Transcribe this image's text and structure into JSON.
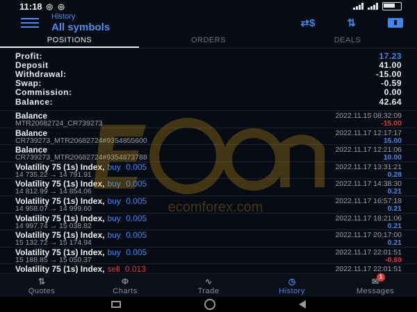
{
  "status": {
    "time": "11:18",
    "left_icons": "◎ ◎",
    "right_icons": "⇅ ▥ ✉",
    "battery_label": ""
  },
  "header": {
    "subtitle": "History",
    "title": "All symbols",
    "currency_icon": "⇄$",
    "sort_icon": "⇅",
    "calendar_icon": "calendar-icon"
  },
  "tabs": [
    {
      "label": "POSITIONS",
      "active": true
    },
    {
      "label": "ORDERS",
      "active": false
    },
    {
      "label": "DEALS",
      "active": false
    }
  ],
  "summary": [
    {
      "label": "Profit:",
      "value": "17.23",
      "blue": true
    },
    {
      "label": "Deposit",
      "value": "41.00",
      "blue": false
    },
    {
      "label": "Withdrawal:",
      "value": "-15.00",
      "blue": false
    },
    {
      "label": "Swap:",
      "value": "-0.59",
      "blue": false
    },
    {
      "label": "Commission:",
      "value": "0.00",
      "blue": false
    },
    {
      "label": "Balance:",
      "value": "42.64",
      "blue": false
    }
  ],
  "deals": [
    {
      "name": "Balance",
      "side": "",
      "volume": "",
      "date": "2022.11.15 08:32:09",
      "sub": "MTR20682724_CR739273",
      "amount": "-15.00",
      "neg": true
    },
    {
      "name": "Balance",
      "side": "",
      "volume": "",
      "date": "2022.11.17 12:17:17",
      "sub": "CR739273_MTR20682724#9354855600",
      "amount": "15.00",
      "neg": false
    },
    {
      "name": "Balance",
      "side": "",
      "volume": "",
      "date": "2022.11.17 12:21:06",
      "sub": "CR739273_MTR20682724#9354873788",
      "amount": "10.00",
      "neg": false
    },
    {
      "name": "Volatility 75 (1s) Index,",
      "side": "buy",
      "volume": "0.005",
      "date": "2022.11.17 13:31:21",
      "sub": "14 735.22 → 14 791.91",
      "amount": "0.28",
      "neg": false
    },
    {
      "name": "Volatility 75 (1s) Index,",
      "side": "buy",
      "volume": "0.005",
      "date": "2022.11.17 14:38:30",
      "sub": "14 812.99 → 14 854.06",
      "amount": "0.21",
      "neg": false
    },
    {
      "name": "Volatility 75 (1s) Index,",
      "side": "buy",
      "volume": "0.005",
      "date": "2022.11.17 16:57:18",
      "sub": "14 958.07 → 14 999.60",
      "amount": "0.21",
      "neg": false
    },
    {
      "name": "Volatility 75 (1s) Index,",
      "side": "buy",
      "volume": "0.005",
      "date": "2022.11.17 18:21:06",
      "sub": "14 997.74 → 15 038.82",
      "amount": "0.21",
      "neg": false
    },
    {
      "name": "Volatility 75 (1s) Index,",
      "side": "buy",
      "volume": "0.005",
      "date": "2022.11.17 20:17:00",
      "sub": "15 132.72 → 15 174.94",
      "amount": "0.21",
      "neg": false
    },
    {
      "name": "Volatility 75 (1s) Index,",
      "side": "buy",
      "volume": "0.005",
      "date": "2022.11.17 22:01:51",
      "sub": "15 188.85 → 15 050.37",
      "amount": "-0.69",
      "neg": true
    },
    {
      "name": "Volatility 75 (1s) Index,",
      "side": "sell",
      "volume": "0.013",
      "date": "2022.11.17 22:01:51",
      "sub": "",
      "amount": "",
      "neg": false
    }
  ],
  "watermark": {
    "text": "ECOM",
    "subtext": "ecomforex.com"
  },
  "bottom_nav": [
    {
      "label": "Quotes",
      "icon": "⇅",
      "active": false
    },
    {
      "label": "Charts",
      "icon": "Φ",
      "active": false
    },
    {
      "label": "Trade",
      "icon": "∿",
      "active": false
    },
    {
      "label": "History",
      "icon": "◷",
      "active": true
    },
    {
      "label": "Messages",
      "icon": "✉",
      "active": false,
      "badge": "1"
    }
  ],
  "colors": {
    "accent": "#3f86f0",
    "negative": "#e0373a",
    "background": "#070b13"
  }
}
